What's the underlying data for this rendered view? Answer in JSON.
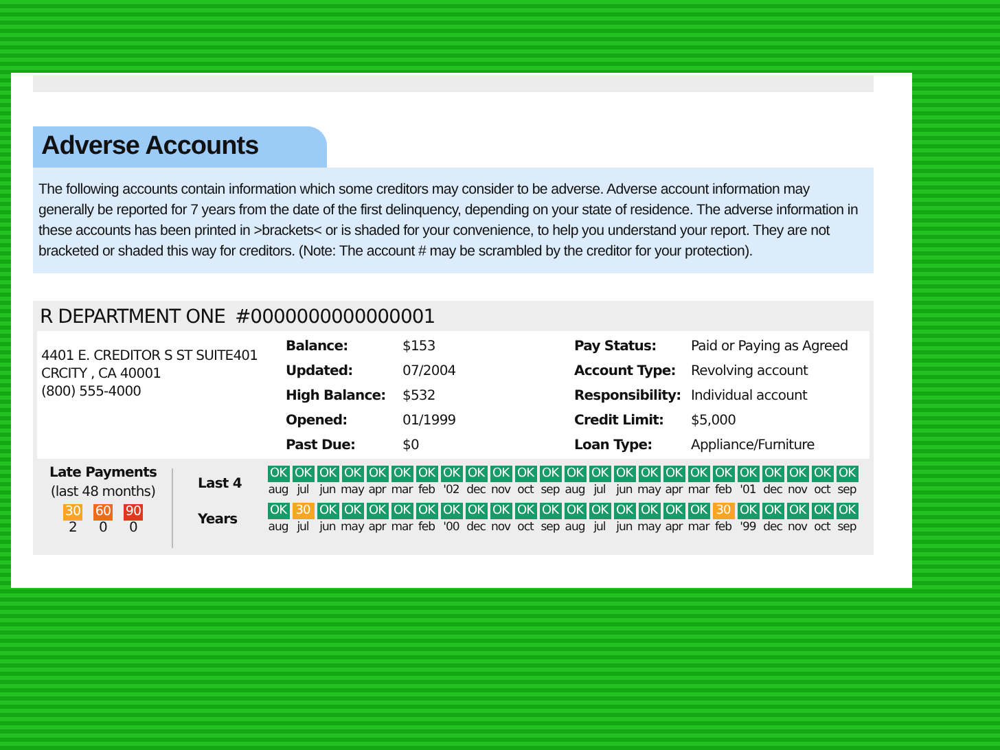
{
  "section_title": "Adverse Accounts",
  "description": "The following accounts contain information which some creditors may consider to be adverse. Adverse account information may generally be reported for 7 years from the date of the first delinquency, depending on your state of residence. The adverse information in these accounts has been printed in >brackets< or is shaded for your convenience, to help you understand your report. They are not bracketed or shaded this way for creditors. (Note: The account # may be scrambled by the creditor for your protection).",
  "account": {
    "name": "R DEPARTMENT ONE",
    "number": "#0000000000000001",
    "address": [
      "4401 E. CREDITOR S ST SUITE401",
      "CRCITY , CA 40001",
      "(800) 555-4000"
    ],
    "details_left": [
      {
        "label": "Balance:",
        "value": "$153"
      },
      {
        "label": "Updated:",
        "value": "07/2004"
      },
      {
        "label": "High Balance:",
        "value": "$532"
      },
      {
        "label": "Opened:",
        "value": "01/1999"
      },
      {
        "label": "Past Due:",
        "value": "$0"
      }
    ],
    "details_right": [
      {
        "label": "Pay Status:",
        "value": "Paid or Paying as Agreed"
      },
      {
        "label": "Account Type:",
        "value": "Revolving account"
      },
      {
        "label": "Responsibility:",
        "value": "Individual account"
      },
      {
        "label": "Credit Limit:",
        "value": "$5,000"
      },
      {
        "label": "Loan Type:",
        "value": "Appliance/Furniture"
      }
    ]
  },
  "late_payments": {
    "title": "Late Payments",
    "subtitle": "(last 48 months)",
    "counts": [
      {
        "kind": "late30",
        "label": "30",
        "count": "2"
      },
      {
        "kind": "late60",
        "label": "60",
        "count": "0"
      },
      {
        "kind": "late90",
        "label": "90",
        "count": "0"
      }
    ]
  },
  "history_labels": [
    "Last 4",
    "Years"
  ],
  "history_rows": [
    [
      {
        "kind": "ok",
        "status": "OK",
        "month": "aug"
      },
      {
        "kind": "ok",
        "status": "OK",
        "month": "jul"
      },
      {
        "kind": "ok",
        "status": "OK",
        "month": "jun"
      },
      {
        "kind": "ok",
        "status": "OK",
        "month": "may"
      },
      {
        "kind": "ok",
        "status": "OK",
        "month": "apr"
      },
      {
        "kind": "ok",
        "status": "OK",
        "month": "mar"
      },
      {
        "kind": "ok",
        "status": "OK",
        "month": "feb"
      },
      {
        "kind": "ok",
        "status": "OK",
        "month": "'02"
      },
      {
        "kind": "ok",
        "status": "OK",
        "month": "dec"
      },
      {
        "kind": "ok",
        "status": "OK",
        "month": "nov"
      },
      {
        "kind": "ok",
        "status": "OK",
        "month": "oct"
      },
      {
        "kind": "ok",
        "status": "OK",
        "month": "sep"
      },
      {
        "kind": "ok",
        "status": "OK",
        "month": "aug"
      },
      {
        "kind": "ok",
        "status": "OK",
        "month": "jul"
      },
      {
        "kind": "ok",
        "status": "OK",
        "month": "jun"
      },
      {
        "kind": "ok",
        "status": "OK",
        "month": "may"
      },
      {
        "kind": "ok",
        "status": "OK",
        "month": "apr"
      },
      {
        "kind": "ok",
        "status": "OK",
        "month": "mar"
      },
      {
        "kind": "ok",
        "status": "OK",
        "month": "feb"
      },
      {
        "kind": "ok",
        "status": "OK",
        "month": "'01"
      },
      {
        "kind": "ok",
        "status": "OK",
        "month": "dec"
      },
      {
        "kind": "ok",
        "status": "OK",
        "month": "nov"
      },
      {
        "kind": "ok",
        "status": "OK",
        "month": "oct"
      },
      {
        "kind": "ok",
        "status": "OK",
        "month": "sep"
      }
    ],
    [
      {
        "kind": "ok",
        "status": "OK",
        "month": "aug"
      },
      {
        "kind": "late30",
        "status": "30",
        "month": "jul"
      },
      {
        "kind": "ok",
        "status": "OK",
        "month": "jun"
      },
      {
        "kind": "ok",
        "status": "OK",
        "month": "may"
      },
      {
        "kind": "ok",
        "status": "OK",
        "month": "apr"
      },
      {
        "kind": "ok",
        "status": "OK",
        "month": "mar"
      },
      {
        "kind": "ok",
        "status": "OK",
        "month": "feb"
      },
      {
        "kind": "ok",
        "status": "OK",
        "month": "'00"
      },
      {
        "kind": "ok",
        "status": "OK",
        "month": "dec"
      },
      {
        "kind": "ok",
        "status": "OK",
        "month": "nov"
      },
      {
        "kind": "ok",
        "status": "OK",
        "month": "oct"
      },
      {
        "kind": "ok",
        "status": "OK",
        "month": "sep"
      },
      {
        "kind": "ok",
        "status": "OK",
        "month": "aug"
      },
      {
        "kind": "ok",
        "status": "OK",
        "month": "jul"
      },
      {
        "kind": "ok",
        "status": "OK",
        "month": "jun"
      },
      {
        "kind": "ok",
        "status": "OK",
        "month": "may"
      },
      {
        "kind": "ok",
        "status": "OK",
        "month": "apr"
      },
      {
        "kind": "ok",
        "status": "OK",
        "month": "mar"
      },
      {
        "kind": "late30",
        "status": "30",
        "month": "feb"
      },
      {
        "kind": "ok",
        "status": "OK",
        "month": "'99"
      },
      {
        "kind": "ok",
        "status": "OK",
        "month": "dec"
      },
      {
        "kind": "ok",
        "status": "OK",
        "month": "nov"
      },
      {
        "kind": "ok",
        "status": "OK",
        "month": "oct"
      },
      {
        "kind": "ok",
        "status": "OK",
        "month": "sep"
      }
    ]
  ]
}
